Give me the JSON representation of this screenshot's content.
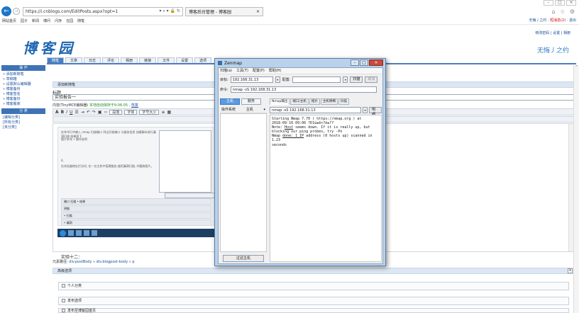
{
  "browser": {
    "window_controls": [
      "–",
      "□",
      "×"
    ],
    "url": "https://i.cnblogs.com/EditPosts.aspx?opt=1",
    "url_controls": "▾ ⌕ ▾ 🔒 ↻",
    "tab_title": "博客后台管理 - 博客园",
    "tab_close": "×",
    "chrome_icons": "⌂ ☆ ⚙",
    "favorites": [
      "网站首页",
      "园子",
      "新闻",
      "博问",
      "闪存",
      "在园",
      "随笔"
    ],
    "top_links": [
      "无悔丿之约",
      "短消息(2)",
      "退出"
    ]
  },
  "site": {
    "account_links": "修改密码 | 设置 | 相册",
    "logo_text": "博客园",
    "user_name": "无悔丿之约"
  },
  "nav": [
    "随笔",
    "文章",
    "日志",
    "评论",
    "相册",
    "链接",
    "文件",
    "设置",
    "选项"
  ],
  "sidebar": {
    "ops_head": "操 作",
    "ops_links": [
      "» 添加新随笔",
      "» 草稿箱",
      "» 设置默认编辑器",
      "» 博客备份",
      "» 博客签名",
      "» 博客备份",
      "» 博客搬家"
    ],
    "cat_head": "分 类",
    "cat_links": [
      "[编辑分类]",
      "[所有分类]",
      "[未分类]"
    ]
  },
  "editor": {
    "section_title": "添加新随笔",
    "title_label": "标题",
    "title_value": "实验报告一",
    "content_label": "内容(TinyMCE编辑器)",
    "autosave_text": "本地自动保存于9:06:05 ,",
    "restore_link": "恢复",
    "font_select": "段落",
    "font_family": "字体",
    "font_size": "字号大小",
    "inner_lines": [
      "在命令行中输入 nmap 扫描端口 列出开放端口 与服务信息 加载脚本进行漏洞扫描 结果如下",
      "图片补充 • 操作说明",
      "4、",
      "在浏览器地址栏访问, 在一台主机中搭建服务,使用漏洞扫描, 并截取图片。"
    ],
    "inner_row_labels": [
      "端口 扫描 • 结果",
      "明细",
      "• 扫描",
      "• 漏洞"
    ],
    "footer_label": "实验十二：",
    "path_label": "元素路径:",
    "path_value": "div.postBody » div.blogpost-body » p",
    "scroll_up": "^",
    "scroll_down": "v"
  },
  "options": {
    "head": "高级选项",
    "toggle": "+",
    "boxes": [
      "个人分类",
      "发布选项",
      "发布至博客园首页"
    ]
  },
  "zenmap": {
    "title": "Zenmap",
    "controls": [
      "–",
      "□",
      "×"
    ],
    "menu": [
      "扫描(a)",
      "工具(T)",
      "配置(P)",
      "帮助(H)"
    ],
    "target_label": "目标:",
    "target_value": "192.168.31.13",
    "profile_label": "配置:",
    "profile_value": "",
    "scan_btn": "扫描",
    "cancel_btn": "取消",
    "command_label": "命令:",
    "command_value": "nmap -sS 192.168.31.13",
    "left_tabs": [
      "主机",
      "服务"
    ],
    "left_head_os": "操作系统",
    "left_head_host": "主机",
    "left_head_arrow": "▾",
    "filter_btn": "过滤主机",
    "tabs": [
      "Nmap输出",
      "端口/主机",
      "拓扑",
      "主机明细",
      "扫描"
    ],
    "out_select": "nmap -sS 192.168.31.13",
    "details_btn": "明细",
    "output": {
      "l1": "Starting Nmap 7.70 ( https://nmap.org ) at",
      "l2": "2018-09-10 09:06 ?D1ú±ê×?ê±??",
      "l3a": "Note: ",
      "l3b": "Host",
      "l3c": " seems down. If it is really up, but",
      "l4": "blocking our ping probes, try -Pn",
      "l5a": "Nmap ",
      "l5b": "done: 1 IP",
      "l5c": " address (0 hosts up) scanned in 1.23",
      "l6": "seconds"
    }
  },
  "colors": {
    "accent": "#4a7fbf",
    "logo": "#1f66b1",
    "zenmap_frame": "#b9d1ea",
    "close_red": "#c94b3e"
  }
}
